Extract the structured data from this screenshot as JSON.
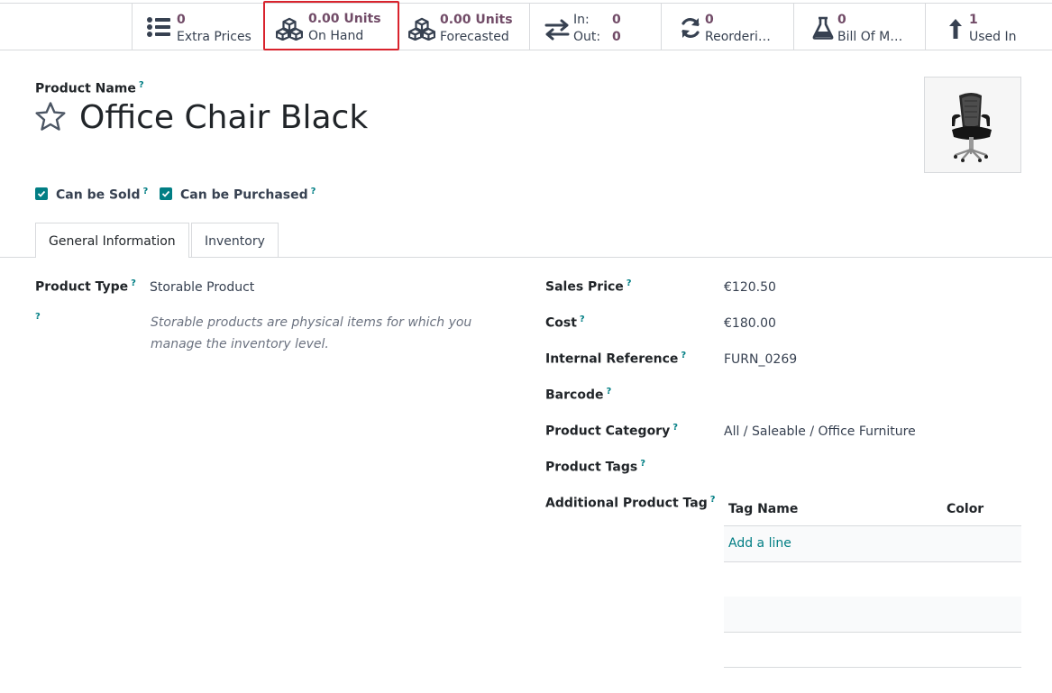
{
  "stat_buttons": {
    "extra_prices": {
      "value": "0",
      "label": "Extra Prices"
    },
    "on_hand": {
      "value": "0.00 Units",
      "label": "On Hand"
    },
    "forecasted": {
      "value": "0.00 Units",
      "label": "Forecasted"
    },
    "in_out": {
      "in_label": "In:",
      "in_value": "0",
      "out_label": "Out:",
      "out_value": "0"
    },
    "reordering": {
      "value": "0",
      "label": "Reorderi…"
    },
    "bom": {
      "value": "0",
      "label": "Bill Of M…"
    },
    "used_in": {
      "value": "1",
      "label": "Used In"
    }
  },
  "header": {
    "product_name_label": "Product Name",
    "product_name": "Office Chair Black",
    "help_mark": "?"
  },
  "checkboxes": {
    "can_be_sold": {
      "label": "Can be Sold",
      "checked": true
    },
    "can_be_purchased": {
      "label": "Can be Purchased",
      "checked": true
    }
  },
  "tabs": [
    {
      "label": "General Information",
      "active": true
    },
    {
      "label": "Inventory",
      "active": false
    }
  ],
  "left_fields": {
    "product_type_label": "Product Type",
    "product_type_value": "Storable Product",
    "product_type_help": "Storable products are physical items for which you manage the inventory level."
  },
  "right_fields": {
    "sales_price": {
      "label": "Sales Price",
      "value": "€120.50"
    },
    "cost": {
      "label": "Cost",
      "value": "€180.00"
    },
    "internal_reference": {
      "label": "Internal Reference",
      "value": "FURN_0269"
    },
    "barcode": {
      "label": "Barcode",
      "value": ""
    },
    "product_category": {
      "label": "Product Category",
      "value": "All / Saleable / Office Furniture"
    },
    "product_tags": {
      "label": "Product Tags",
      "value": ""
    },
    "additional_product_tag": {
      "label": "Additional Product Tag"
    }
  },
  "tag_table": {
    "col_tag_name": "Tag Name",
    "col_color": "Color",
    "add_line": "Add a line"
  },
  "colors": {
    "accent": "#714b67",
    "teal": "#017e84",
    "highlight": "#d9232d"
  }
}
